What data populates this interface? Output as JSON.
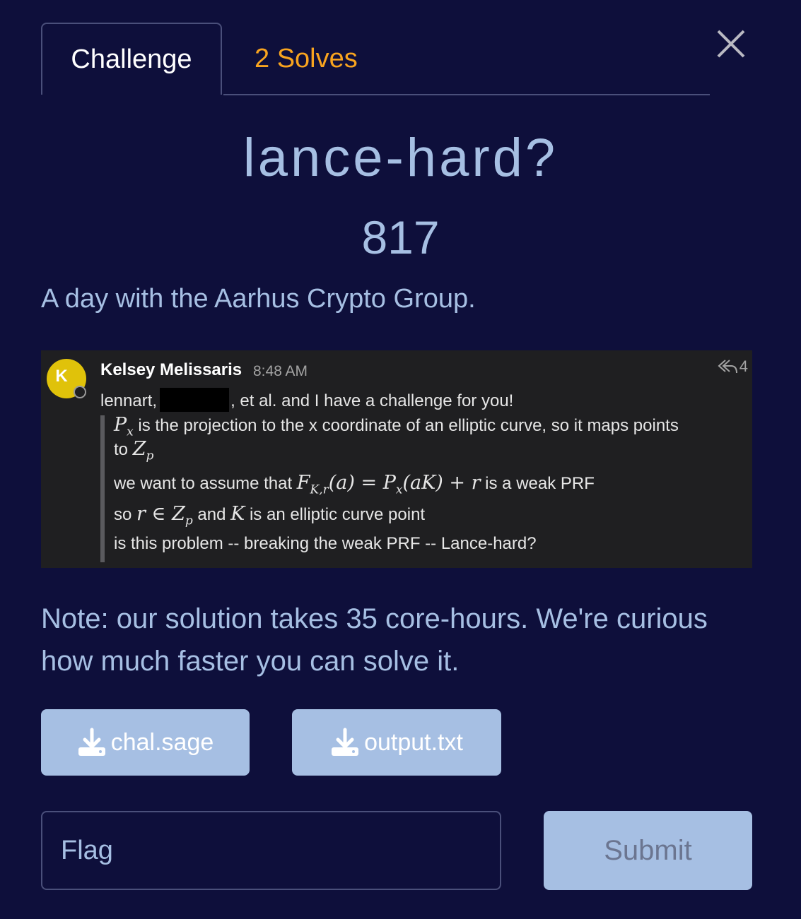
{
  "tabs": {
    "challenge": "Challenge",
    "solves": "2 Solves"
  },
  "challenge": {
    "name": "lance-hard?",
    "points": "817",
    "description": "A day with the Aarhus Crypto Group."
  },
  "message": {
    "avatar_letter": "K",
    "author": "Kelsey Melissaris",
    "time": "8:48 AM",
    "reply_count": "4",
    "line1_prefix": "lennart,",
    "line1_suffix": ", et al. and I have a challenge for you!",
    "quote": {
      "l1_text": " is the projection to the x coordinate of an elliptic curve, so it maps points",
      "l2_prefix": "to ",
      "l3_prefix": "we want to assume that ",
      "l3_suffix": " is a weak PRF",
      "l4_prefix": "so ",
      "l4_mid": " and ",
      "l4_suffix": " is an elliptic curve point",
      "l5_text": "is this problem -- breaking the weak PRF -- Lance-hard?"
    }
  },
  "note": "Note: our solution takes 35 core-hours. We're curious how much faster you can solve it.",
  "downloads": [
    {
      "label": "chal.sage",
      "icon": "download-icon"
    },
    {
      "label": "output.txt",
      "icon": "download-icon"
    }
  ],
  "flag_input": {
    "placeholder": "Flag",
    "value": ""
  },
  "submit_label": "Submit",
  "colors": {
    "background": "#0e0f3b",
    "accent": "#a6bfe3",
    "solves": "#f8a41f",
    "chat_bg": "#1f1f21"
  }
}
